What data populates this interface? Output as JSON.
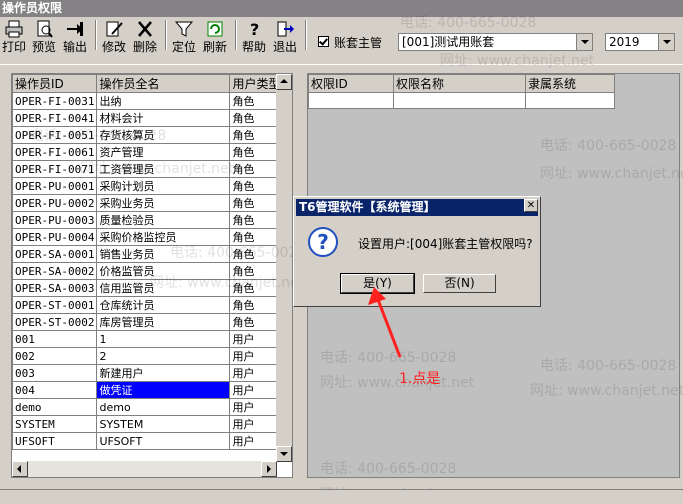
{
  "window": {
    "title": "操作员权限"
  },
  "toolbar": {
    "buttons": [
      {
        "label": "打印",
        "icon": "printer-icon"
      },
      {
        "label": "预览",
        "icon": "preview-icon"
      },
      {
        "label": "输出",
        "icon": "export-icon"
      },
      {
        "label": "修改",
        "icon": "edit-icon"
      },
      {
        "label": "删除",
        "icon": "delete-icon"
      },
      {
        "label": "定位",
        "icon": "filter-icon"
      },
      {
        "label": "刷新",
        "icon": "refresh-icon"
      },
      {
        "label": "帮助",
        "icon": "help-icon"
      },
      {
        "label": "退出",
        "icon": "exit-icon"
      }
    ],
    "master_checkbox_label": "账套主管",
    "account_combo": "[001]测试用账套",
    "year_combo": "2019"
  },
  "operator_table": {
    "columns": [
      "操作员ID",
      "操作员全名",
      "用户类型"
    ],
    "rows": [
      [
        "OPER-FI-0031",
        "出纳",
        "角色"
      ],
      [
        "OPER-FI-0041",
        "材料会计",
        "角色"
      ],
      [
        "OPER-FI-0051",
        "存货核算员",
        "角色"
      ],
      [
        "OPER-FI-0061",
        "资产管理",
        "角色"
      ],
      [
        "OPER-FI-0071",
        "工资管理员",
        "角色"
      ],
      [
        "OPER-PU-0001",
        "采购计划员",
        "角色"
      ],
      [
        "OPER-PU-0002",
        "采购业务员",
        "角色"
      ],
      [
        "OPER-PU-0003",
        "质量检验员",
        "角色"
      ],
      [
        "OPER-PU-0004",
        "采购价格监控员",
        "角色"
      ],
      [
        "OPER-SA-0001",
        "销售业务员",
        "角色"
      ],
      [
        "OPER-SA-0002",
        "价格监管员",
        "角色"
      ],
      [
        "OPER-SA-0003",
        "信用监管员",
        "角色"
      ],
      [
        "OPER-ST-0001",
        "仓库统计员",
        "角色"
      ],
      [
        "OPER-ST-0002",
        "库房管理员",
        "角色"
      ],
      [
        "001",
        "1",
        "用户"
      ],
      [
        "002",
        "2",
        "用户"
      ],
      [
        "003",
        "新建用户",
        "用户"
      ],
      [
        "004",
        "做凭证",
        "用户"
      ],
      [
        "demo",
        "demo",
        "用户"
      ],
      [
        "SYSTEM",
        "SYSTEM",
        "用户"
      ],
      [
        "UFSOFT",
        "UFSOFT",
        "用户"
      ]
    ],
    "selected_index": 17
  },
  "permission_table": {
    "columns": [
      "权限ID",
      "权限名称",
      "隶属系统"
    ]
  },
  "dialog": {
    "title": "T6管理软件【系统管理】",
    "message": "设置用户:[004]账套主管权限吗?",
    "yes_label": "是(Y)",
    "no_label": "否(N)",
    "close_glyph": "✕",
    "question_glyph": "?"
  },
  "annotation": {
    "text": "1.点是",
    "color": "#ff2020"
  },
  "watermarks": [
    "电话: 400-665-0028",
    "网址: www.chanjet.net"
  ]
}
